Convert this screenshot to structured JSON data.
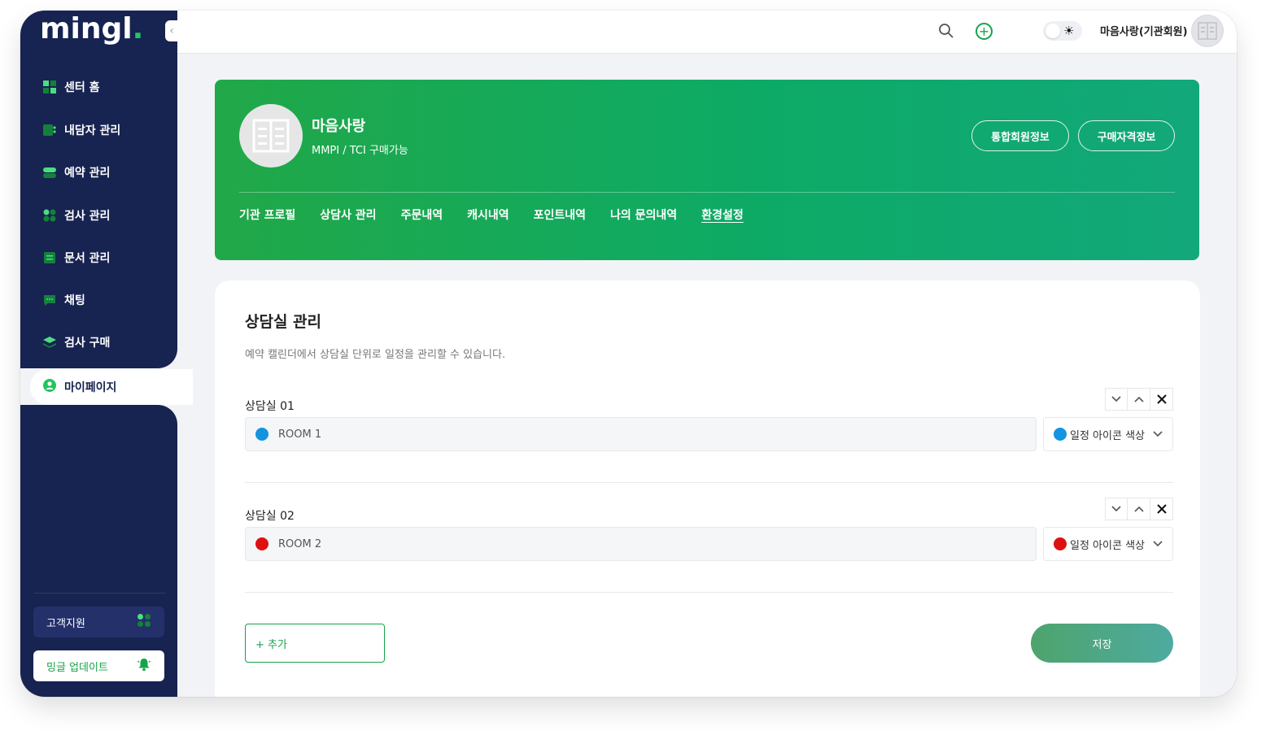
{
  "brand": {
    "logo_text": "mingl",
    "logo_dot": ".",
    "accent": "#16a34a",
    "navy": "#172350"
  },
  "sidebar": {
    "items": [
      {
        "label": "센터 홈",
        "icon": "home-grid-icon"
      },
      {
        "label": "내담자 관리",
        "icon": "client-card-icon"
      },
      {
        "label": "예약 관리",
        "icon": "reservation-toggle-icon"
      },
      {
        "label": "검사 관리",
        "icon": "test-dots-icon"
      },
      {
        "label": "문서 관리",
        "icon": "document-icon"
      },
      {
        "label": "채팅",
        "icon": "chat-bubble-icon"
      },
      {
        "label": "검사 구매",
        "icon": "layers-icon"
      }
    ],
    "active": {
      "label": "마이페이지",
      "icon": "user-circle-icon"
    },
    "support_label": "고객지원",
    "update_label": "밍글 업데이트"
  },
  "topbar": {
    "user_label": "마음사랑(기관회원)",
    "theme": "light"
  },
  "org": {
    "name": "마음사랑",
    "subtitle": "MMPI / TCI 구매가능",
    "btn_member": "통합회원정보",
    "btn_purchase": "구매자격정보",
    "tabs": [
      "기관 프로필",
      "상담사 관리",
      "주문내역",
      "캐시내역",
      "포인트내역",
      "나의 문의내역",
      "환경설정"
    ],
    "active_tab": "환경설정"
  },
  "rooms_section": {
    "title": "상담실 관리",
    "description": "예약 캘린더에서 상담실 단위로 일정을 관리할 수 있습니다.",
    "rooms": [
      {
        "label": "상담실 01",
        "name": "ROOM 1",
        "color": "#1493e0",
        "color_label": "일정 아이콘 색상"
      },
      {
        "label": "상담실 02",
        "name": "ROOM 2",
        "color": "#dd1111",
        "color_label": "일정 아이콘 색상"
      }
    ],
    "add_label": "+ 추가",
    "save_label": "저장"
  }
}
